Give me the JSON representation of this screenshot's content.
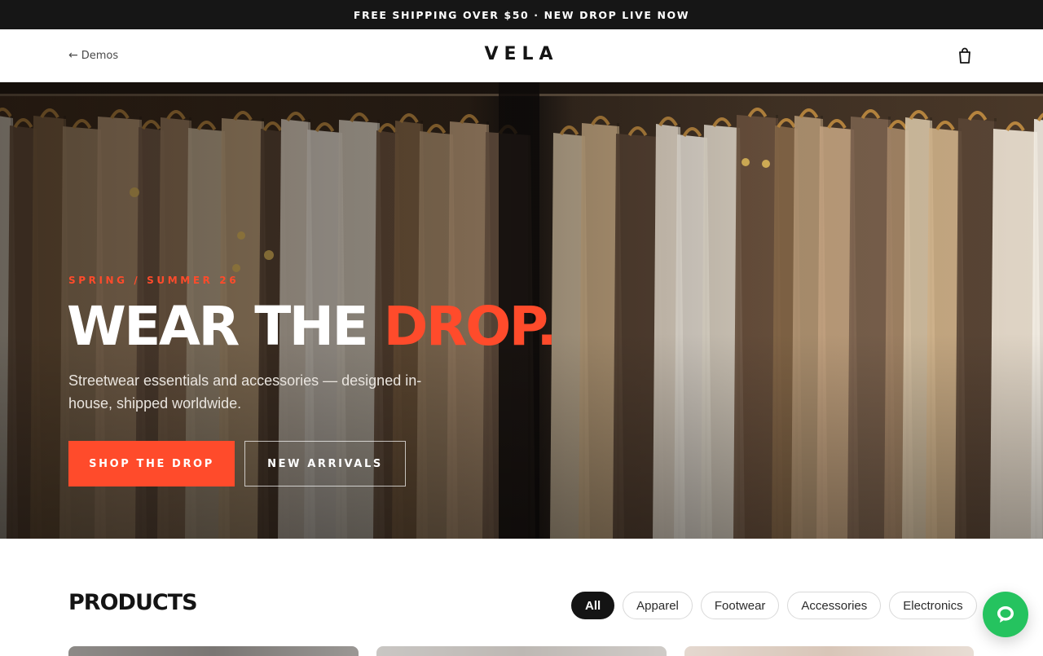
{
  "announcement": "FREE SHIPPING OVER $50 · NEW DROP LIVE NOW",
  "header": {
    "back_arrow": "←",
    "back_label": "Demos",
    "logo": "VELA",
    "cart_icon": "shopping-bag-icon"
  },
  "hero": {
    "eyebrow": "SPRING / SUMMER 26",
    "headline_main": "WEAR THE ",
    "headline_accent": "DROP.",
    "subtext": "Streetwear essentials and accessories — designed in-house, shipped worldwide.",
    "primary_cta": "SHOP THE DROP",
    "secondary_cta": "NEW ARRIVALS",
    "image": "clothing-rack-photo"
  },
  "products": {
    "title": "PRODUCTS",
    "filters": [
      {
        "label": "All",
        "active": true
      },
      {
        "label": "Apparel",
        "active": false
      },
      {
        "label": "Footwear",
        "active": false
      },
      {
        "label": "Accessories",
        "active": false
      },
      {
        "label": "Electronics",
        "active": false
      }
    ]
  },
  "chat": {
    "icon": "chat-bubble-icon"
  },
  "colors": {
    "accent": "#ff4b2b",
    "announcement_bg": "#161616",
    "chat_green": "#25c35f"
  }
}
